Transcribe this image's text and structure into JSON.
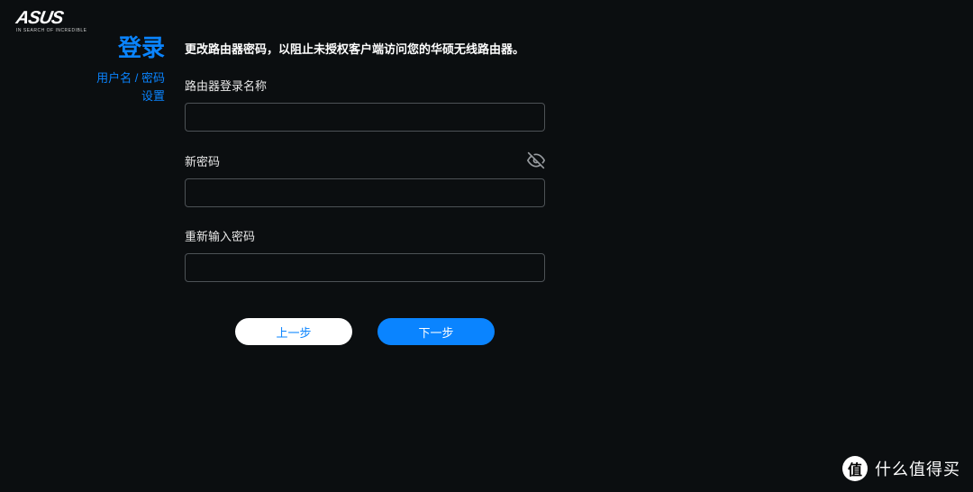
{
  "brand": {
    "name": "ASUS",
    "tagline": "IN SEARCH OF INCREDIBLE"
  },
  "sidebar": {
    "title": "登录",
    "subtitle_line1": "用户名 / 密码",
    "subtitle_line2": "设置"
  },
  "main": {
    "instruction": "更改路由器密码，以阻止未授权客户端访问您的华硕无线路由器。",
    "fields": {
      "login_name": {
        "label": "路由器登录名称",
        "value": ""
      },
      "new_password": {
        "label": "新密码",
        "value": ""
      },
      "retype_password": {
        "label": "重新输入密码",
        "value": ""
      }
    },
    "buttons": {
      "prev": "上一步",
      "next": "下一步"
    }
  },
  "watermark": {
    "badge": "值",
    "text": "什么值得买"
  },
  "colors": {
    "accent": "#0a84ff",
    "background": "#0b0e10",
    "border": "#4d5256"
  }
}
